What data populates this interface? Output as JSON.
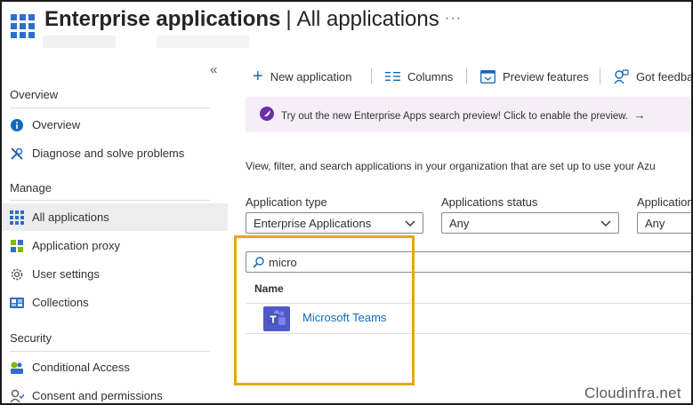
{
  "header": {
    "title_main": "Enterprise applications",
    "title_separator": "|",
    "title_sub": "All applications",
    "more_label": "···"
  },
  "sidebar": {
    "collapse_label": "«",
    "sections": {
      "overview": "Overview",
      "manage": "Manage",
      "security": "Security"
    },
    "items": [
      {
        "label": "Overview",
        "icon": "info-icon"
      },
      {
        "label": "Diagnose and solve problems",
        "icon": "wrench-icon"
      },
      {
        "label": "All applications",
        "icon": "grid-icon",
        "selected": true
      },
      {
        "label": "Application proxy",
        "icon": "proxy-icon"
      },
      {
        "label": "User settings",
        "icon": "gear-icon"
      },
      {
        "label": "Collections",
        "icon": "collections-icon"
      },
      {
        "label": "Conditional Access",
        "icon": "conditional-access-icon"
      },
      {
        "label": "Consent and permissions",
        "icon": "consent-icon"
      }
    ]
  },
  "toolbar": {
    "new_application": "New application",
    "columns": "Columns",
    "preview_features": "Preview features",
    "got_feedback": "Got feedba"
  },
  "banner": {
    "text": "Try out the new Enterprise Apps search preview! Click to enable the preview.",
    "arrow": "→"
  },
  "description": "View, filter, and search applications in your organization that are set up to use your Azu",
  "filters": {
    "application_type": {
      "label": "Application type",
      "value": "Enterprise Applications"
    },
    "applications_status": {
      "label": "Applications status",
      "value": "Any"
    },
    "application_visibility": {
      "label": "Application",
      "value": "Any"
    }
  },
  "search": {
    "value": "micro"
  },
  "table": {
    "column_name": "Name",
    "rows": [
      {
        "name": "Microsoft Teams",
        "icon": "teams-icon"
      }
    ]
  },
  "watermark": "Cloudinfra.net",
  "colors": {
    "accent": "#0f6cbd",
    "highlight": "#e6a716",
    "banner_bg": "#f5eef8",
    "teams": "#5059c9"
  }
}
